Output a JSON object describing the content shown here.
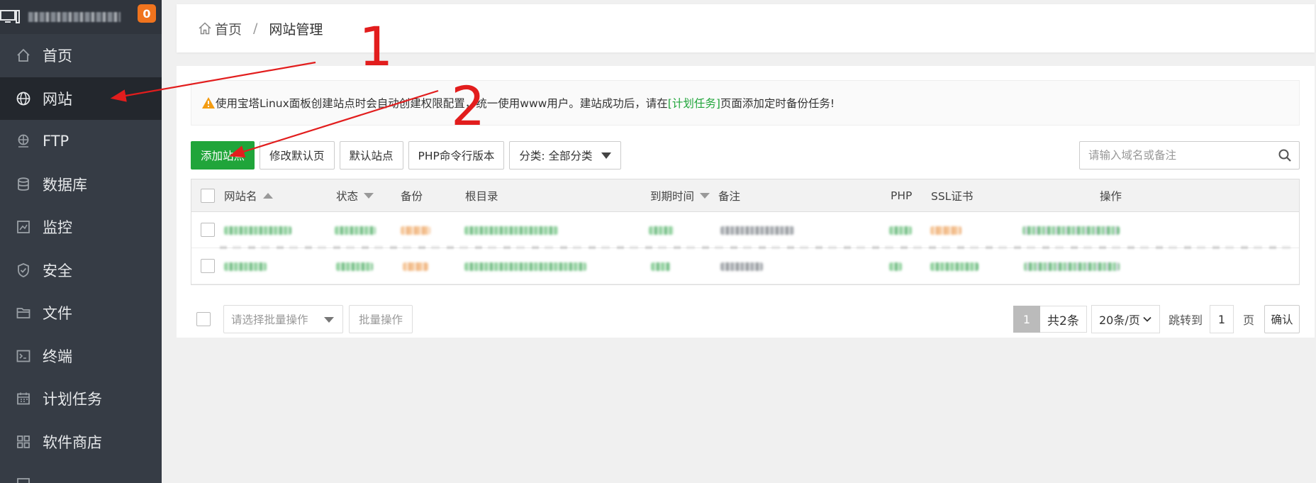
{
  "brand": {
    "badge": "0"
  },
  "sidebar": {
    "items": [
      {
        "label": "首页",
        "icon": "home-icon"
      },
      {
        "label": "网站",
        "icon": "globe-icon",
        "active": true
      },
      {
        "label": "FTP",
        "icon": "ftp-icon"
      },
      {
        "label": "数据库",
        "icon": "database-icon"
      },
      {
        "label": "监控",
        "icon": "monitor-chart-icon"
      },
      {
        "label": "安全",
        "icon": "shield-icon"
      },
      {
        "label": "文件",
        "icon": "folder-icon"
      },
      {
        "label": "终端",
        "icon": "terminal-icon"
      },
      {
        "label": "计划任务",
        "icon": "calendar-icon"
      },
      {
        "label": "软件商店",
        "icon": "apps-icon"
      }
    ]
  },
  "breadcrumb": {
    "home": "首页",
    "separator": "/",
    "current": "网站管理"
  },
  "notice": {
    "text_before": "使用宝塔Linux面板创建站点时会自动创建权限配置，统一使用www用户。建站成功后，请在",
    "link": "[计划任务]",
    "text_after": "页面添加定时备份任务!"
  },
  "toolbar": {
    "add_site": "添加站点",
    "modify_default_page": "修改默认页",
    "default_site": "默认站点",
    "php_cli_version": "PHP命令行版本",
    "category": "分类: 全部分类"
  },
  "search": {
    "placeholder": "请输入域名或备注"
  },
  "table": {
    "columns": {
      "name": "网站名",
      "status": "状态",
      "backup": "备份",
      "root": "根目录",
      "expire": "到期时间",
      "remark": "备注",
      "php": "PHP",
      "ssl": "SSL证书",
      "actions": "操作"
    }
  },
  "pager": {
    "batch_placeholder": "请选择批量操作",
    "batch_button": "批量操作",
    "current_page": "1",
    "total": "共2条",
    "page_size": "20条/页",
    "jump_to": "跳转到",
    "jump_value": "1",
    "page_unit": "页",
    "confirm": "确认"
  },
  "annotations": {
    "step1": "1",
    "step2": "2"
  },
  "colors": {
    "accent_green": "#20a53a",
    "sidebar_bg": "#363c45",
    "annotation_red": "#e21d1d",
    "badge_orange": "#f0741e"
  }
}
